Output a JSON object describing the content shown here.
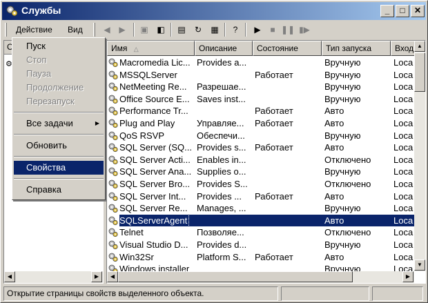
{
  "window": {
    "title": "Службы"
  },
  "menu": {
    "action": "Действие",
    "view": "Вид"
  },
  "left_pane": {
    "tab_label": "С"
  },
  "columns": [
    "Имя",
    "Описание",
    "Состояние",
    "Тип запуска",
    "Вход"
  ],
  "services": [
    {
      "name": "Macromedia Lic...",
      "desc": "Provides a...",
      "state": "",
      "startup": "Вручную",
      "logon": "Loca"
    },
    {
      "name": "MSSQLServer",
      "desc": "",
      "state": "Работает",
      "startup": "Вручную",
      "logon": "Loca"
    },
    {
      "name": "NetMeeting Re...",
      "desc": "Разрешае...",
      "state": "",
      "startup": "Вручную",
      "logon": "Loca"
    },
    {
      "name": "Office Source E...",
      "desc": "Saves inst...",
      "state": "",
      "startup": "Вручную",
      "logon": "Loca"
    },
    {
      "name": "Performance Tr...",
      "desc": "",
      "state": "Работает",
      "startup": "Авто",
      "logon": "Loca"
    },
    {
      "name": "Plug and Play",
      "desc": "Управляе...",
      "state": "Работает",
      "startup": "Авто",
      "logon": "Loca"
    },
    {
      "name": "QoS RSVP",
      "desc": "Обеспечи...",
      "state": "",
      "startup": "Вручную",
      "logon": "Loca"
    },
    {
      "name": "SQL Server (SQ...",
      "desc": "Provides s...",
      "state": "Работает",
      "startup": "Авто",
      "logon": "Loca"
    },
    {
      "name": "SQL Server Acti...",
      "desc": "Enables in...",
      "state": "",
      "startup": "Отключено",
      "logon": "Loca"
    },
    {
      "name": "SQL Server Ana...",
      "desc": "Supplies o...",
      "state": "",
      "startup": "Вручную",
      "logon": "Loca"
    },
    {
      "name": "SQL Server Bro...",
      "desc": "Provides S...",
      "state": "",
      "startup": "Отключено",
      "logon": "Loca"
    },
    {
      "name": "SQL Server Int...",
      "desc": "Provides ...",
      "state": "Работает",
      "startup": "Авто",
      "logon": "Loca"
    },
    {
      "name": "SQL Server Re...",
      "desc": "Manages, ...",
      "state": "",
      "startup": "Вручную",
      "logon": "Loca"
    },
    {
      "name": "SQLServerAgent",
      "desc": "",
      "state": "",
      "startup": "Авто",
      "logon": "Loca",
      "selected": true
    },
    {
      "name": "Telnet",
      "desc": "Позволяе...",
      "state": "",
      "startup": "Отключено",
      "logon": "Loca"
    },
    {
      "name": "Visual Studio D...",
      "desc": "Provides d...",
      "state": "",
      "startup": "Вручную",
      "logon": "Loca"
    },
    {
      "name": "Win32Sr",
      "desc": "Platform S...",
      "state": "Работает",
      "startup": "Авто",
      "logon": "Loca"
    },
    {
      "name": "Windows installer",
      "desc": "",
      "state": "",
      "startup": "Вручную",
      "logon": "Loca"
    }
  ],
  "context_menu": {
    "start": "Пуск",
    "stop": "Стоп",
    "pause": "Пауза",
    "resume": "Продолжение",
    "restart": "Перезапуск",
    "all_tasks": "Все задачи",
    "refresh": "Обновить",
    "properties": "Свойства",
    "help": "Справка"
  },
  "status": {
    "text": "Открытие страницы свойств выделенного объекта."
  },
  "colors": {
    "titlebar_start": "#0a246a",
    "titlebar_end": "#a6caf0",
    "selection": "#0a246a",
    "face": "#d4d0c8"
  }
}
